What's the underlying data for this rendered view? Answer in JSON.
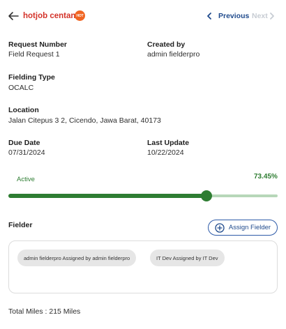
{
  "header": {
    "title": "hotjob centang",
    "badge_text": "HOT",
    "prev_label": "Previous",
    "next_label": "Next"
  },
  "fields": {
    "request_number": {
      "label": "Request Number",
      "value": "Field Request 1"
    },
    "created_by": {
      "label": "Created by",
      "value": "admin fielderpro"
    },
    "fielding_type": {
      "label": "Fielding Type",
      "value": "OCALC"
    },
    "location": {
      "label": "Location",
      "value": "Jalan Citepus 3 2, Cicendo, Jawa Barat, 40173"
    },
    "due_date": {
      "label": "Due Date",
      "value": "07/31/2024"
    },
    "last_update": {
      "label": "Last Update",
      "value": "10/22/2024"
    }
  },
  "progress": {
    "status": "Active",
    "percent_label": "73.45%",
    "fraction": 0.7345
  },
  "fielder": {
    "label": "Fielder",
    "assign_label": "Assign Fielder",
    "assignees": [
      "admin fielderpro Assigned by admin fielderpro",
      "IT Dev Assigned by IT Dev"
    ]
  },
  "total_miles": "Total Miles : 215 Miles",
  "colors": {
    "title_red": "#d3332a",
    "primary_blue": "#1f4a8c",
    "progress_green": "#2e7d32",
    "track_light_green": "#b7d7b9",
    "hot_badge_orange": "#f06522"
  },
  "icons": {
    "back": "arrow-left-icon",
    "hot": "hot-badge-icon",
    "previous": "chevron-left-icon",
    "next": "chevron-right-icon",
    "assign": "plus-circle-icon"
  }
}
